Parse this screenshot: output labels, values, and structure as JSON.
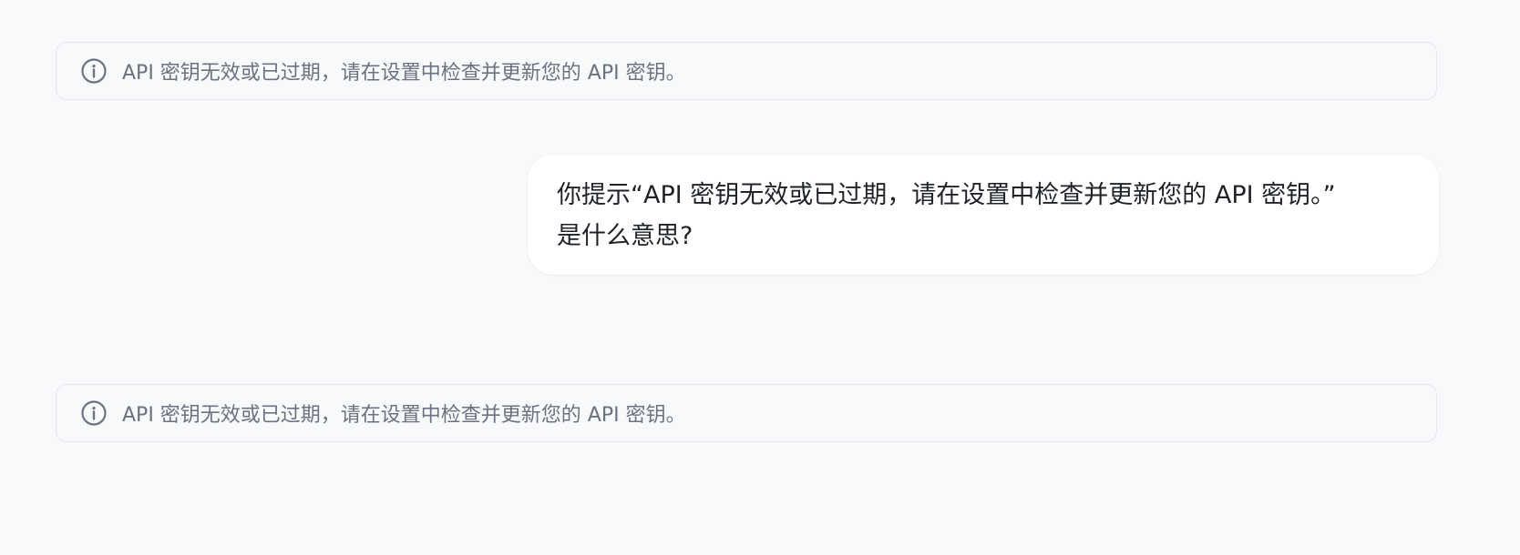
{
  "notices": [
    {
      "icon": "info-icon",
      "text": "API 密钥无效或已过期，请在设置中检查并更新您的 API 密钥。"
    },
    {
      "icon": "info-icon",
      "text": "API 密钥无效或已过期，请在设置中检查并更新您的 API 密钥。"
    }
  ],
  "user_message": {
    "line1": "你提示“API 密钥无效或已过期，请在设置中检查并更新您的 API 密钥。”",
    "line2": "是什么意思?"
  },
  "colors": {
    "background": "#f8f9fb",
    "notice_border": "#e5e7eb",
    "notice_text": "#6b7280",
    "bubble_background": "#ffffff",
    "bubble_text": "#1f2328"
  }
}
